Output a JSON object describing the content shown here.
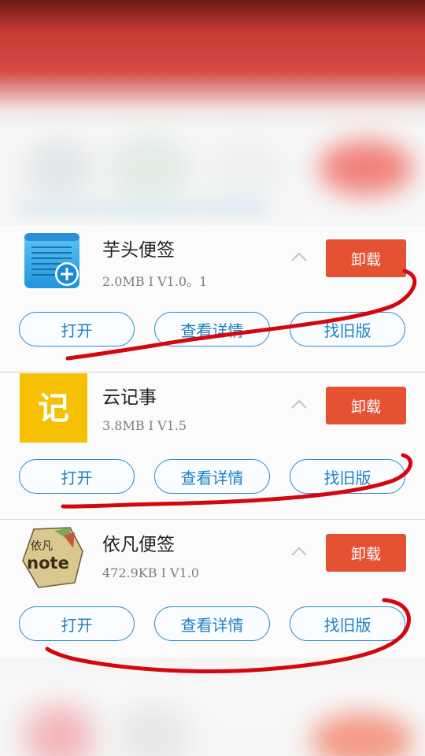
{
  "apps": [
    {
      "name": "芋头便签",
      "meta": "2.0MB I V1.0。1",
      "uninstall_label": "卸载",
      "buttons": [
        "打开",
        "查看详情",
        "找旧版"
      ],
      "icon": "notepad-plus-icon"
    },
    {
      "name": "云记事",
      "meta": "3.8MB I V1.5",
      "uninstall_label": "卸载",
      "buttons": [
        "打开",
        "查看详情",
        "找旧版"
      ],
      "icon": "yun-ji-icon",
      "icon_text": "记"
    },
    {
      "name": "依凡便签",
      "meta": "472.9KB I V1.0",
      "uninstall_label": "卸载",
      "buttons": [
        "打开",
        "查看详情",
        "找旧版"
      ],
      "icon": "yifan-note-icon",
      "icon_text_top": "依凡",
      "icon_text_main": "note"
    }
  ],
  "colors": {
    "uninstall": "#e55233",
    "pill_border": "#2b89cc",
    "scribble": "#d4070f"
  }
}
